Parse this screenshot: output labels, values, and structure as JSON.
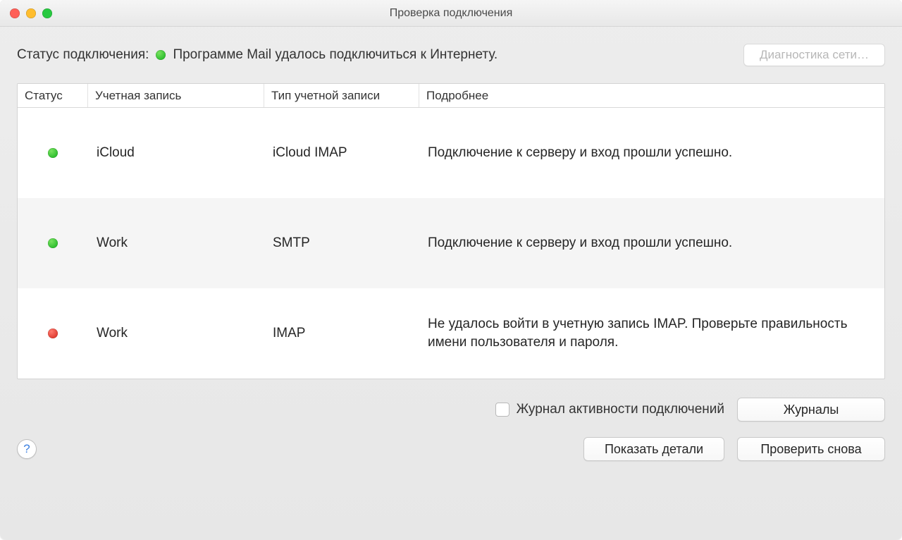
{
  "window": {
    "title": "Проверка подключения"
  },
  "status": {
    "label": "Статус подключения:",
    "indicator": "green",
    "message": "Программе Mail удалось подключиться к Интернету.",
    "diagnostics_button": "Диагностика сети…"
  },
  "table": {
    "headers": {
      "status": "Статус",
      "account": "Учетная запись",
      "type": "Тип учетной записи",
      "detail": "Подробнее"
    },
    "rows": [
      {
        "status": "green",
        "account": "iCloud",
        "type": "iCloud IMAP",
        "detail": "Подключение к серверу и вход прошли успешно."
      },
      {
        "status": "green",
        "account": "Work",
        "type": "SMTP",
        "detail": "Подключение к серверу и вход прошли успешно."
      },
      {
        "status": "red",
        "account": "Work",
        "type": "IMAP",
        "detail": "Не удалось войти в учетную запись IMAP. Проверьте правильность имени пользователя и пароля."
      }
    ]
  },
  "footer": {
    "activity_log_checkbox": "Журнал активности подключений",
    "logs_button": "Журналы",
    "show_details_button": "Показать детали",
    "check_again_button": "Проверить снова",
    "help": "?"
  },
  "colors": {
    "green": "#2fbf2f",
    "red": "#e13e33"
  }
}
